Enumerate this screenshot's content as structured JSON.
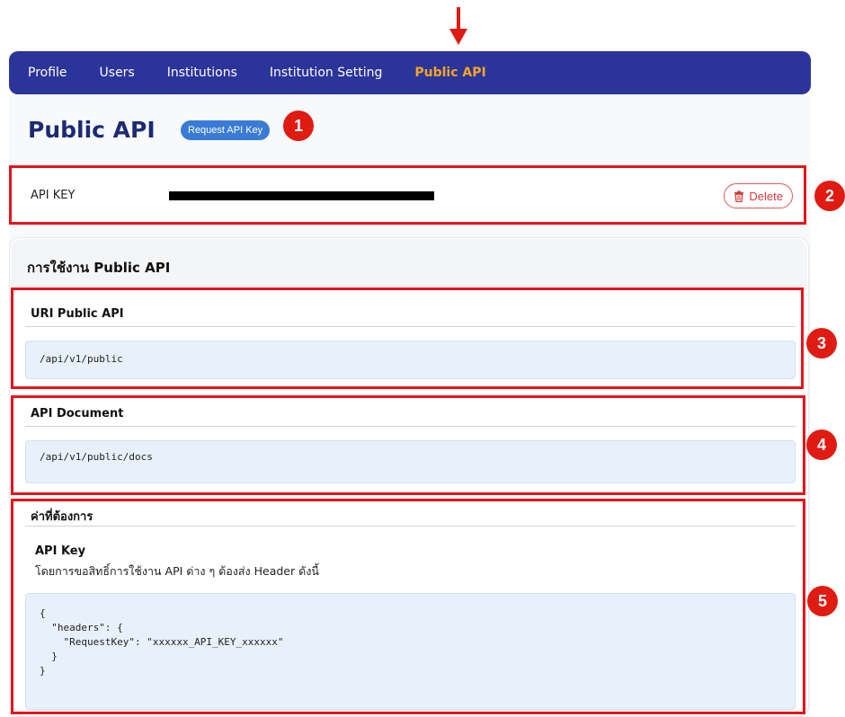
{
  "nav": {
    "items": [
      {
        "label": "Profile",
        "active": false
      },
      {
        "label": "Users",
        "active": false
      },
      {
        "label": "Institutions",
        "active": false
      },
      {
        "label": "Institution Setting",
        "active": false
      },
      {
        "label": "Public API",
        "active": true
      }
    ]
  },
  "header": {
    "title": "Public API",
    "request_button": "Request API Key"
  },
  "api_key": {
    "label": "API KEY",
    "value_redacted": true,
    "delete_label": "Delete"
  },
  "usage": {
    "title": "การใช้งาน Public API",
    "uri_section": {
      "title": "URI Public API",
      "code": "/api/v1/public"
    },
    "doc_section": {
      "title": "API Document",
      "code": "/api/v1/public/docs"
    },
    "required_section": {
      "title": "ค่าที่ต้องการ",
      "subtitle": "API Key",
      "description": "โดยการขอสิทธิ์การใช้งาน API ต่าง ๆ ต้องส่ง Header ดังนี้",
      "code_lines": [
        "{",
        "  \"headers\": {",
        "    \"RequestKey\": \"xxxxxx_API_KEY_xxxxxx\"",
        "  }",
        "}"
      ]
    }
  },
  "callouts": [
    "1",
    "2",
    "3",
    "4",
    "5"
  ],
  "colors": {
    "navbar": "#2b3499",
    "nav_active": "#f5a623",
    "title": "#1c2a74",
    "highlight_border": "#e4141b",
    "callout": "#e01b12",
    "code_bg": "#e8f1fb"
  }
}
